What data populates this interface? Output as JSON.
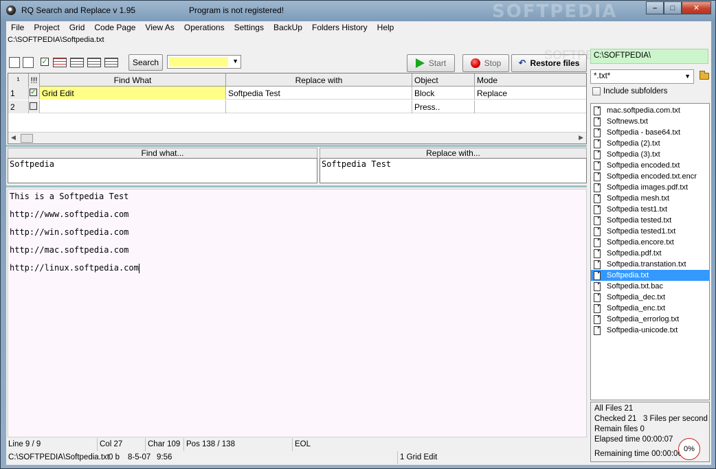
{
  "window": {
    "title": "RQ Search and Replace v 1.95",
    "registration": "Program is not registered!",
    "watermark": "SOFTPEDIA",
    "btn_min": "–",
    "btn_max": "□",
    "btn_close": "✕"
  },
  "menu": [
    "File",
    "Project",
    "Grid",
    "Code Page",
    "View As",
    "Operations",
    "Settings",
    "BackUp",
    "Folders History",
    "Help"
  ],
  "current_file": "C:\\SOFTPEDIA\\Softpedia.txt",
  "toolbar": {
    "check": "✓",
    "search_label": "Search",
    "start_label": "Start",
    "stop_label": "Stop",
    "restore_label": "Restore files"
  },
  "grid": {
    "headers": {
      "num": "¹",
      "flag": "!!!",
      "find": "Find What",
      "replace": "Replace with",
      "object": "Object",
      "mode": "Mode"
    },
    "rows": [
      {
        "num": "1",
        "check": "✓",
        "find": "Grid Edit",
        "replace": "Softpedia Test",
        "object": "Block",
        "mode": "Replace"
      },
      {
        "num": "2",
        "check": "",
        "find": "",
        "replace": "",
        "object": "Press..",
        "mode": ""
      }
    ],
    "scroll_left": "◀",
    "scroll_right": "▶"
  },
  "find_panel": {
    "label": "Find what...",
    "value": "Softpedia"
  },
  "replace_panel": {
    "label": "Replace with...",
    "value": "Softpedia Test"
  },
  "editor": {
    "lines": [
      "This is a Softpedia Test",
      "http://www.softpedia.com",
      "http://win.softpedia.com",
      "http://mac.softpedia.com",
      "http://linux.softpedia.com"
    ]
  },
  "status": {
    "line": "Line 9 / 9",
    "col": "Col 27",
    "char": "Char 109",
    "pos": "Pos 138 / 138",
    "eol": "EOL",
    "file": "C:\\SOFTPEDIA\\Softpedia.txt",
    "size": "0 b",
    "date": "8-5-07",
    "time": "9:56",
    "grid_info": "1 Grid Edit"
  },
  "right_panel": {
    "folder": "C:\\SOFTPEDIA\\",
    "filter": "*.txt*",
    "include_subfolders": "Include subfolders",
    "files": [
      "mac.softpedia.com.txt",
      "Softnews.txt",
      "Softpedia - base64.txt",
      "Softpedia (2).txt",
      "Softpedia (3).txt",
      "Softpedia encoded.txt",
      "Softpedia encoded.txt.encr",
      "Softpedia images.pdf.txt",
      "Softpedia mesh.txt",
      "Softpedia test1.txt",
      "Softpedia tested.txt",
      "Softpedia tested1.txt",
      "Softpedia.encore.txt",
      "Softpedia.pdf.txt",
      "Softpedia.transtation.txt",
      "Softpedia.txt",
      "Softpedia.txt.bac",
      "Softpedia_dec.txt",
      "Softpedia_enc.txt",
      "Softpedia_errorlog.txt",
      "Softpedia-unicode.txt"
    ],
    "selected_file": "Softpedia.txt"
  },
  "stats": {
    "all_files": "All Files 21",
    "checked": "Checked 21",
    "speed": "3 Files per second",
    "remain": "Remain files 0",
    "elapsed": "Elapsed time 00:00:07",
    "remaining_time": "Remaining time 00:00:00",
    "progress": "0%"
  }
}
